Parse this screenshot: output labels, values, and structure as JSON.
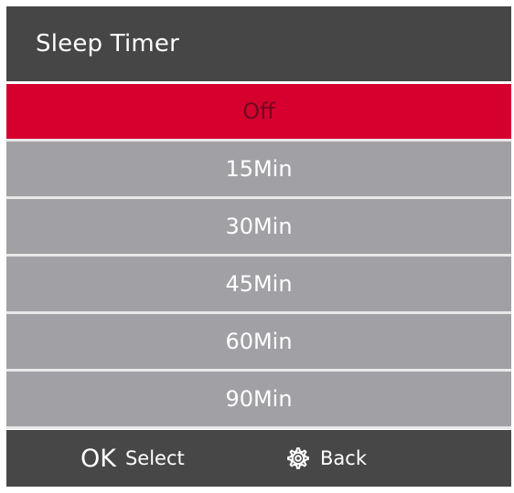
{
  "title_bar": {
    "title": "Sleep Timer"
  },
  "menu": {
    "items": [
      {
        "label": "Off",
        "selected": true
      },
      {
        "label": "15Min",
        "selected": false
      },
      {
        "label": "30Min",
        "selected": false
      },
      {
        "label": "45Min",
        "selected": false
      },
      {
        "label": "60Min",
        "selected": false
      },
      {
        "label": "90Min",
        "selected": false
      }
    ]
  },
  "footer": {
    "ok_key": "OK",
    "select_label": "Select",
    "back_icon": "gear-icon",
    "back_label": "Back"
  },
  "colors": {
    "title_bar": "#464646",
    "selected_item": "#d6002f",
    "item": "#a1a1a5",
    "footer": "#474747"
  }
}
